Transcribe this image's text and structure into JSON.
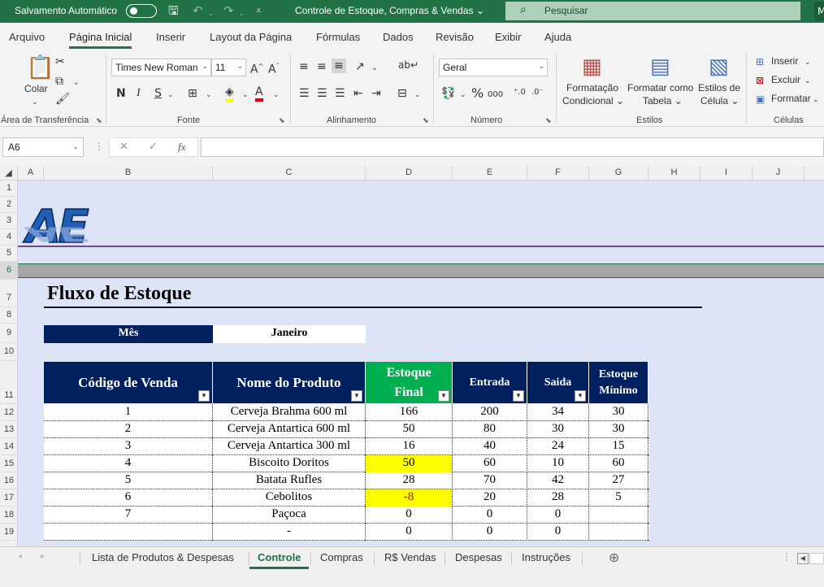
{
  "titlebar": {
    "autosave_label": "Salvamento Automático",
    "doc_title": "Controle de Estoque, Compras & Vendas",
    "title_caret": "⌄",
    "search_placeholder": "Pesquisar",
    "user_initial": "M"
  },
  "ribbon_tabs": [
    "Arquivo",
    "Página Inicial",
    "Inserir",
    "Layout da Página",
    "Fórmulas",
    "Dados",
    "Revisão",
    "Exibir",
    "Ajuda"
  ],
  "ribbon": {
    "clipboard": {
      "paste_label": "Colar",
      "group_label": "Área de Transferência"
    },
    "font": {
      "font_name": "Times New Roman",
      "font_size": "11",
      "group_label": "Fonte",
      "bold": "N",
      "italic": "I",
      "underline": "S"
    },
    "alignment": {
      "group_label": "Alinhamento"
    },
    "number": {
      "format": "Geral",
      "group_label": "Número"
    },
    "styles": {
      "cond_format_l1": "Formatação",
      "cond_format_l2": "Condicional ⌄",
      "table_format_l1": "Formatar como",
      "table_format_l2": "Tabela ⌄",
      "cell_styles_l1": "Estilos de",
      "cell_styles_l2": "Célula ⌄",
      "group_label": "Estilos"
    },
    "cells": {
      "insert": "Inserir",
      "delete": "Excluir",
      "format": "Formatar",
      "group_label": "Células"
    }
  },
  "formula_bar": {
    "name_box": "A6",
    "fx": "fx",
    "formula": ""
  },
  "columns": [
    "A",
    "B",
    "C",
    "D",
    "E",
    "F",
    "G",
    "H",
    "I",
    "J"
  ],
  "rows": [
    "1",
    "2",
    "3",
    "4",
    "5",
    "6",
    "7",
    "8",
    "9",
    "10",
    "11",
    "12",
    "13",
    "14",
    "15",
    "16",
    "17",
    "18",
    "19"
  ],
  "sheet": {
    "logo_text": "AE",
    "title": "Fluxo de Estoque",
    "month_label": "Mês",
    "month_value": "Janeiro",
    "table_headers": {
      "codigo": "Código de Venda",
      "nome": "Nome do Produto",
      "estoque_final_l1": "Estoque",
      "estoque_final_l2": "Final",
      "entrada": "Entrada",
      "saida": "Saida",
      "estoque_min_l1": "Estoque",
      "estoque_min_l2": "Mínimo"
    },
    "table_rows": [
      {
        "codigo": "1",
        "nome": "Cerveja Brahma 600 ml",
        "estoque_final": "166",
        "entrada": "200",
        "saida": "34",
        "estoque_min": "30",
        "highlight": false
      },
      {
        "codigo": "2",
        "nome": "Cerveja Antartica 600 ml",
        "estoque_final": "50",
        "entrada": "80",
        "saida": "30",
        "estoque_min": "30",
        "highlight": false
      },
      {
        "codigo": "3",
        "nome": "Cerveja Antartica 300 ml",
        "estoque_final": "16",
        "entrada": "40",
        "saida": "24",
        "estoque_min": "15",
        "highlight": false
      },
      {
        "codigo": "4",
        "nome": "Biscoito Doritos",
        "estoque_final": "50",
        "entrada": "60",
        "saida": "10",
        "estoque_min": "60",
        "highlight": true
      },
      {
        "codigo": "5",
        "nome": "Batata Rufles",
        "estoque_final": "28",
        "entrada": "70",
        "saida": "42",
        "estoque_min": "27",
        "highlight": false
      },
      {
        "codigo": "6",
        "nome": "Cebolitos",
        "estoque_final": "-8",
        "entrada": "20",
        "saida": "28",
        "estoque_min": "5",
        "highlight": true
      },
      {
        "codigo": "7",
        "nome": "Paçoca",
        "estoque_final": "0",
        "entrada": "0",
        "saida": "0",
        "estoque_min": "",
        "highlight": false
      },
      {
        "codigo": "",
        "nome": "-",
        "estoque_final": "0",
        "entrada": "0",
        "saida": "0",
        "estoque_min": "",
        "highlight": false
      }
    ]
  },
  "sheet_tabs": [
    "Lista de Produtos & Despesas",
    "Controle",
    "Compras",
    "R$ Vendas",
    "Despesas",
    "Instruções"
  ],
  "active_sheet": "Controle",
  "colors": {
    "excel_green": "#217346",
    "header_navy": "#002060",
    "header_green": "#00b050",
    "highlight_yellow": "#ffff00",
    "sheet_bg": "#dce4f5"
  }
}
